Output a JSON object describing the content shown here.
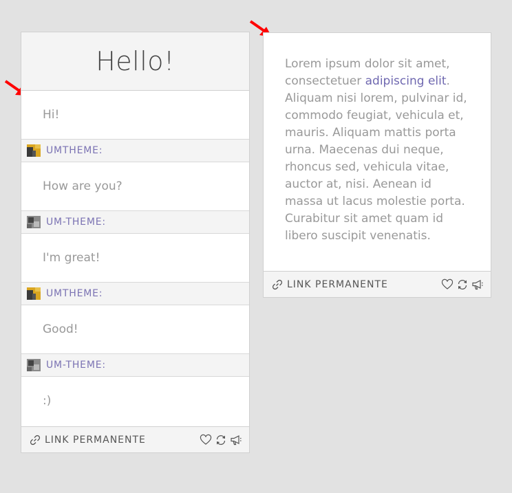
{
  "chat_post": {
    "title": "Hello!",
    "lines": [
      {
        "text": "Hi!",
        "speaker": "UMTHEME:"
      },
      {
        "text": "How are you?",
        "speaker": "UM-THEME:"
      },
      {
        "text": "I'm great!",
        "speaker": "UMTHEME:"
      },
      {
        "text": "Good!",
        "speaker": "UM-THEME:"
      },
      {
        "text": ":)"
      }
    ],
    "footer": {
      "permalink": "LINK PERMANENTE"
    }
  },
  "text_post": {
    "body_before": "Lorem ipsum dolor sit amet, consectetuer ",
    "link": "adipiscing elit",
    "body_after": ". Aliquam nisi lorem, pulvinar id, commodo feugiat, vehicula et, mauris. Aliquam mattis porta urna. Maecenas dui neque, rhoncus sed, vehicula vitae, auctor at, nisi. Aenean id massa ut lacus molestie porta. Curabitur sit amet quam id libero suscipit venenatis.",
    "footer": {
      "permalink": "LINK PERMANENTE"
    }
  },
  "icons": [
    "link-icon",
    "heart-icon",
    "reblog-icon",
    "megaphone-icon",
    "red-arrow-icon"
  ],
  "colors": {
    "accent": "#7b73b3",
    "arrow": "#ff0000",
    "background": "#e2e2e2"
  }
}
